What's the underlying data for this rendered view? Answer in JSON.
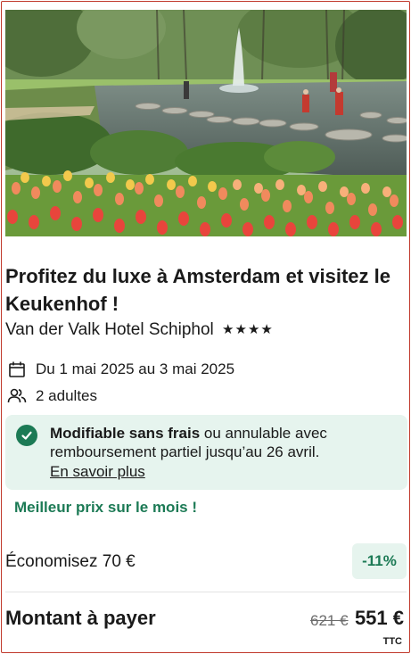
{
  "photo": {
    "alt": "Keukenhof"
  },
  "offer": {
    "title": "Profitez du luxe à Amsterdam et visitez le Keukenhof !",
    "hotel_name": "Van der Valk Hotel Schiphol",
    "stars": "★★★★",
    "star_count": 4,
    "dates": "Du 1 mai 2025 au 3 mai 2025",
    "guests": "2 adultes"
  },
  "cancellation": {
    "bold": "Modifiable sans frais",
    "rest": " ou annulable avec remboursement partiel jusqu’au 26 avril.",
    "link": "En savoir plus"
  },
  "best_price": "Meilleur prix sur le mois !",
  "savings": {
    "label": "Économisez 70 €",
    "badge": "-11%"
  },
  "payment": {
    "label": "Montant à payer",
    "old_price": "621 €",
    "new_price": "551 €",
    "tax_note": "TTC"
  },
  "colors": {
    "accent_green": "#1c7a55",
    "light_green_bg": "#e6f4ee",
    "card_border": "#c0392b"
  },
  "icons": {
    "calendar": "calendar-icon",
    "guests": "people-icon",
    "check": "check-circle-icon"
  }
}
